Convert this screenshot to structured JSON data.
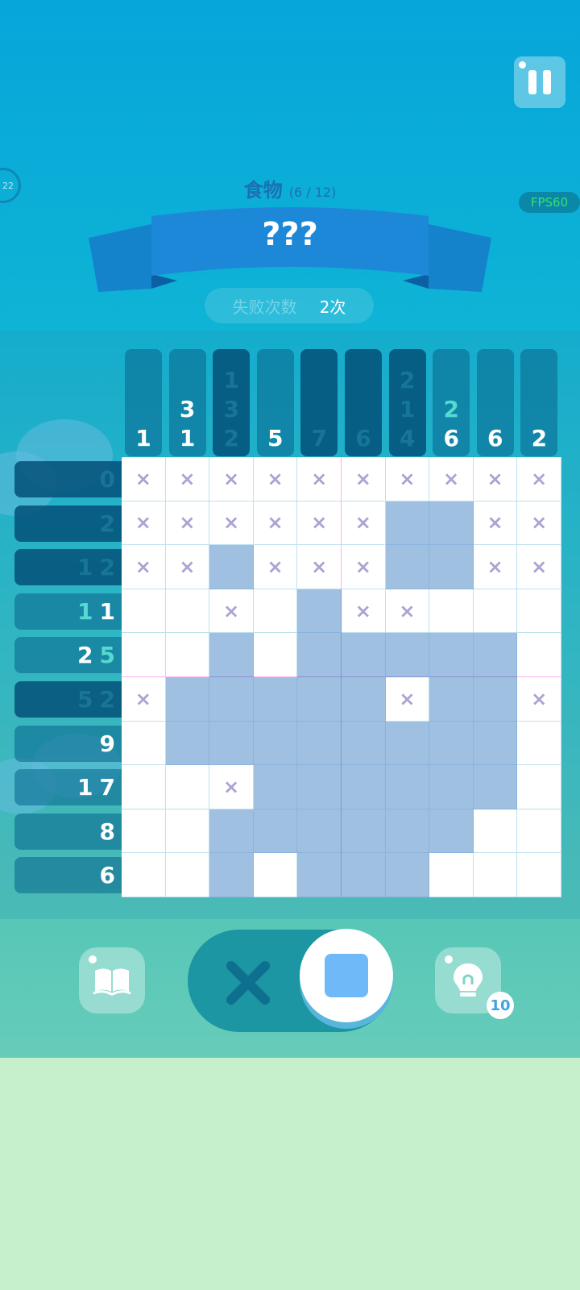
{
  "header": {
    "category": "食物",
    "progress": "(6 / 12)",
    "puzzle_title": "???",
    "fail_label": "失败次数",
    "fail_value": "2次",
    "fps_label": "FPS60",
    "left_badge": "22"
  },
  "column_clues": [
    {
      "values": [
        "1"
      ],
      "teal": [],
      "dim": false,
      "dark": false
    },
    {
      "values": [
        "3",
        "1"
      ],
      "teal": [],
      "dim": false,
      "dark": false
    },
    {
      "values": [
        "1",
        "3",
        "2"
      ],
      "teal": [],
      "dim": true,
      "dark": true
    },
    {
      "values": [
        "5"
      ],
      "teal": [],
      "dim": false,
      "dark": false
    },
    {
      "values": [
        "7"
      ],
      "teal": [],
      "dim": true,
      "dark": true
    },
    {
      "values": [
        "6"
      ],
      "teal": [],
      "dim": true,
      "dark": true
    },
    {
      "values": [
        "2",
        "1",
        "4"
      ],
      "teal": [],
      "dim": true,
      "dark": true
    },
    {
      "values": [
        "2",
        "6"
      ],
      "teal": [
        0
      ],
      "dim": false,
      "dark": false
    },
    {
      "values": [
        "6"
      ],
      "teal": [],
      "dim": false,
      "dark": false
    },
    {
      "values": [
        "2"
      ],
      "teal": [],
      "dim": false,
      "dark": false
    }
  ],
  "row_clues": [
    {
      "values": [
        "0"
      ],
      "teal": [],
      "dim": true,
      "dark": true
    },
    {
      "values": [
        "2"
      ],
      "teal": [],
      "dim": true,
      "dark": true
    },
    {
      "values": [
        "1",
        "2"
      ],
      "teal": [],
      "dim": true,
      "dark": true
    },
    {
      "values": [
        "1",
        "1"
      ],
      "teal": [
        0
      ],
      "dim": false,
      "dark": false
    },
    {
      "values": [
        "2",
        "5"
      ],
      "teal": [
        1
      ],
      "dim": false,
      "dark": false
    },
    {
      "values": [
        "5",
        "2"
      ],
      "teal": [],
      "dim": true,
      "dark": true
    },
    {
      "values": [
        "9"
      ],
      "teal": [],
      "dim": false,
      "dark": false
    },
    {
      "values": [
        "1",
        "7"
      ],
      "teal": [],
      "dim": false,
      "dark": false
    },
    {
      "values": [
        "8"
      ],
      "teal": [],
      "dim": false,
      "dark": false
    },
    {
      "values": [
        "6"
      ],
      "teal": [],
      "dim": false,
      "dark": false
    }
  ],
  "grid": [
    "XXXXXXXXXX",
    "XXXXXX##XX",
    "XX#XXX##XX",
    "..X.#XX...",
    "..#.#####.",
    "X#####X##X",
    ".########.",
    "..X######.",
    "..######..",
    "..#.###..."
  ],
  "grid_legend": {
    "#": "filled",
    "X": "crossed",
    ".": "empty"
  },
  "cross_symbol": "×",
  "controls": {
    "book_icon": "book-icon",
    "hint_icon": "lightbulb-icon",
    "hint_count": "10",
    "selected_mode": "fill"
  },
  "colors": {
    "filled_cell": "#9fc0e0",
    "cross_mark": "#a9a4d3",
    "teal_clue": "#56d9d0",
    "fill_mode": "#6fb9f8"
  }
}
